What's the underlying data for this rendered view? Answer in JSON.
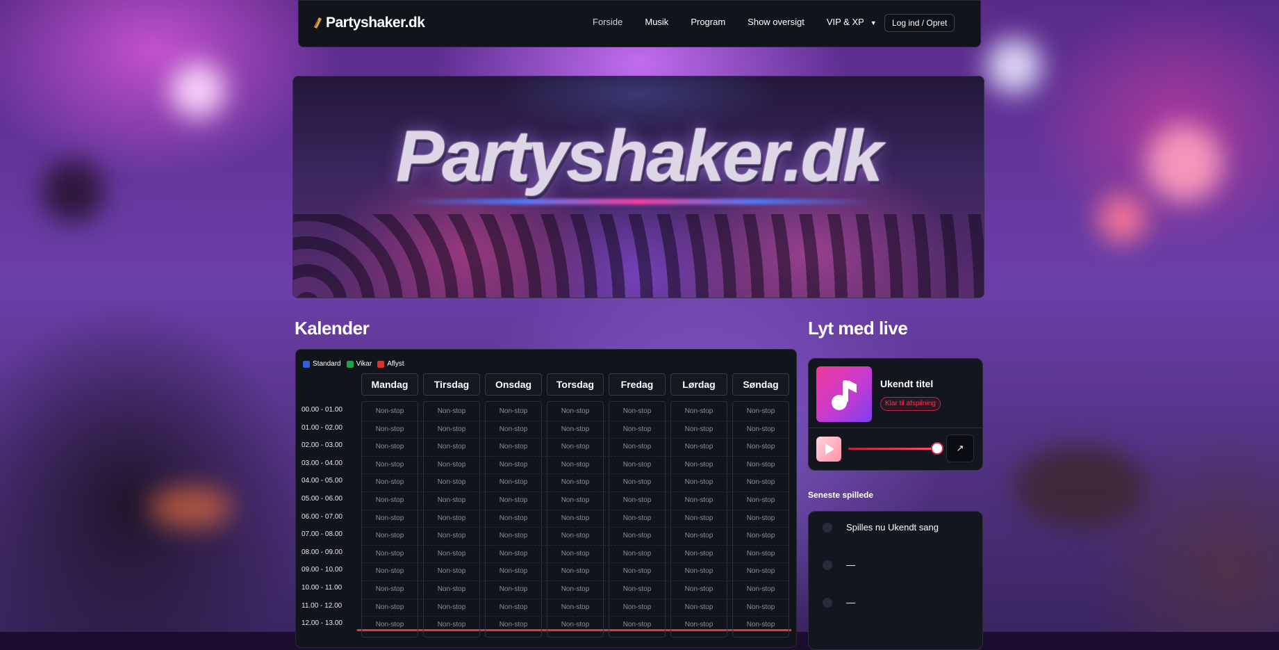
{
  "navbar": {
    "brand": "Partyshaker.dk",
    "items": [
      {
        "label": "Forside",
        "active": true
      },
      {
        "label": "Musik"
      },
      {
        "label": "Program"
      },
      {
        "label": "Show oversigt"
      },
      {
        "label": "VIP & XP",
        "dropdown": true
      }
    ],
    "login_label": "Log ind / Opret"
  },
  "banner": {
    "title": "Partyshaker.dk"
  },
  "calendar": {
    "heading": "Kalender",
    "legend": [
      {
        "label": "Standard",
        "color": "#2f5fe0"
      },
      {
        "label": "Vikar",
        "color": "#1fa34a"
      },
      {
        "label": "Aflyst",
        "color": "#d93030"
      }
    ],
    "days": [
      "Mandag",
      "Tirsdag",
      "Onsdag",
      "Torsdag",
      "Fredag",
      "Lørdag",
      "Søndag"
    ],
    "times": [
      "00.00 - 01.00",
      "01.00 - 02.00",
      "02.00 - 03.00",
      "03.00 - 04.00",
      "04.00 - 05.00",
      "05.00 - 06.00",
      "06.00 - 07.00",
      "07.00 - 08.00",
      "08.00 - 09.00",
      "09.00 - 10.00",
      "10.00 - 11.00",
      "11.00 - 12.00",
      "12.00 - 13.00"
    ],
    "cell_text": "Non-stop",
    "now_line_color": "#e03a3a"
  },
  "live": {
    "heading": "Lyt med live",
    "track_title": "Ukendt titel",
    "status": "Klar til afspilning",
    "volume": 1.0,
    "popout_icon": "↗"
  },
  "recent": {
    "heading": "Seneste spillede",
    "items": [
      "Spilles nu Ukendt sang",
      "—",
      "—"
    ]
  }
}
